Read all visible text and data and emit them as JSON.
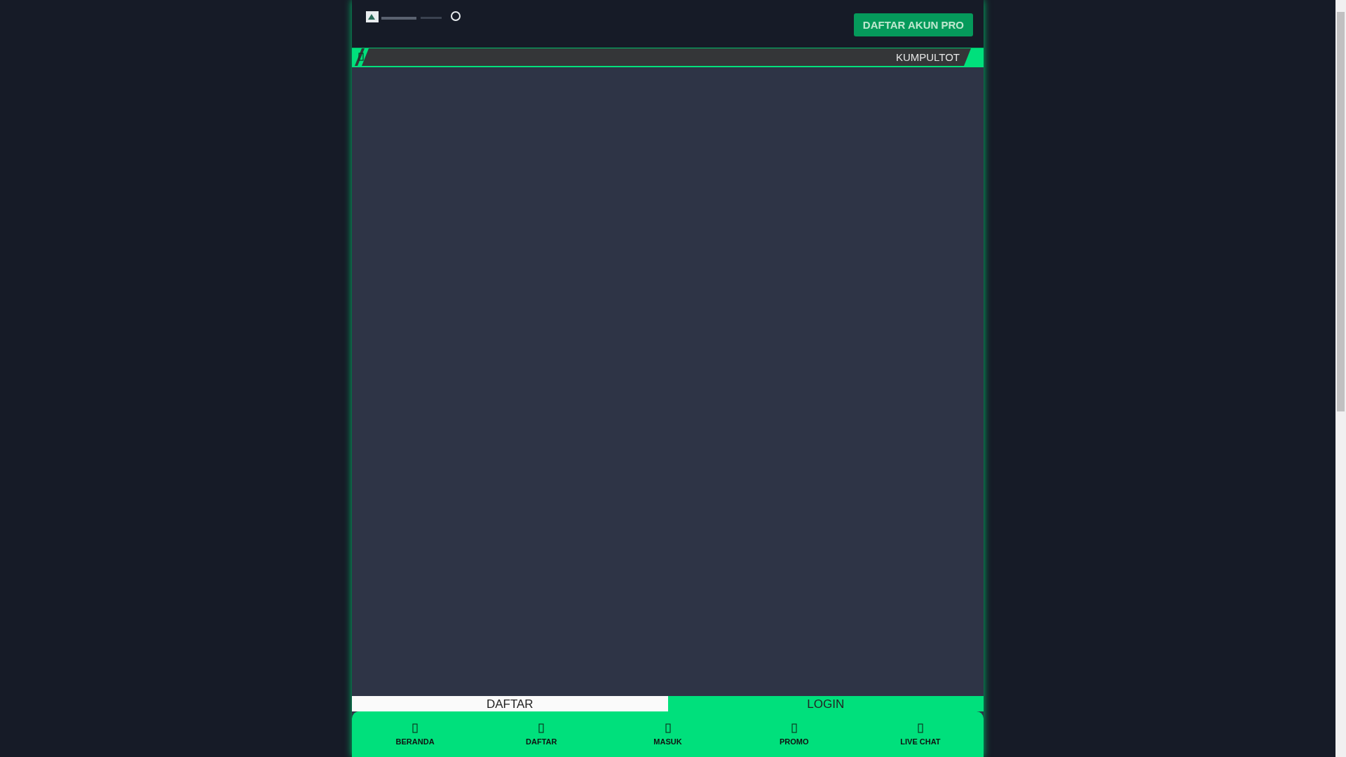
{
  "header": {
    "button": "DAFTAR AKUN PRO"
  },
  "ticker": {
    "text": "KUMPULTOT"
  },
  "tabs": [
    {
      "label": "DAFTAR",
      "selected": false
    },
    {
      "label": "LOGIN",
      "selected": true
    }
  ],
  "bottom_nav": [
    {
      "label": "BERANDA"
    },
    {
      "label": "DAFTAR"
    },
    {
      "label": "MASUK"
    },
    {
      "label": "PROMO"
    },
    {
      "label": "LIVE CHAT"
    }
  ]
}
